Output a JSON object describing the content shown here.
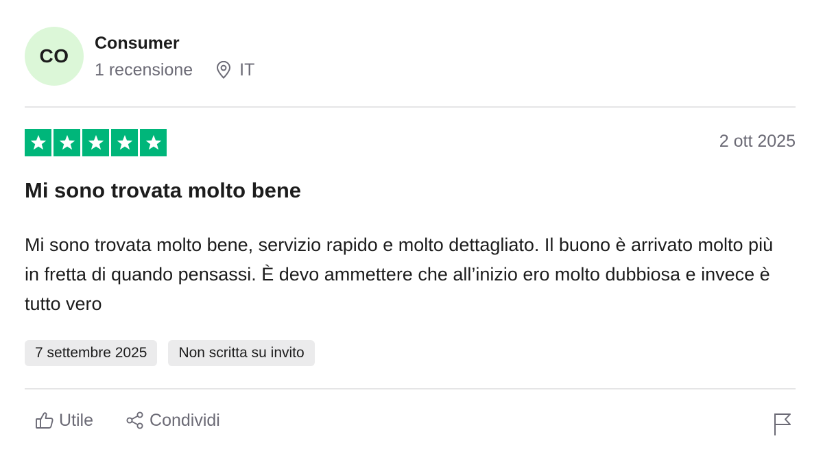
{
  "reviewer": {
    "initials": "CO",
    "name": "Consumer",
    "review_count": "1 recensione",
    "location_icon": "map-pin-icon",
    "country": "IT"
  },
  "review": {
    "rating": 5,
    "rating_max": 5,
    "star_color": "#00b67a",
    "date": "2 ott 2025",
    "title": "Mi sono trovata molto bene",
    "body": "Mi sono trovata molto bene, servizio rapido e molto dettagliato. Il buono è arrivato molto più in fretta di quando pensassi. È devo ammettere che all’inizio ero molto dubbiosa e invece è tutto vero",
    "tags": [
      {
        "label": "7 settembre 2025"
      },
      {
        "label": "Non scritta su invito"
      }
    ]
  },
  "actions": {
    "useful_label": "Utile",
    "useful_icon": "thumbs-up-icon",
    "share_label": "Condividi",
    "share_icon": "share-icon",
    "report_icon": "flag-icon"
  },
  "colors": {
    "avatar_bg": "#dcf7d8",
    "muted_text": "#6b6a75",
    "tag_bg": "#ebebec"
  }
}
